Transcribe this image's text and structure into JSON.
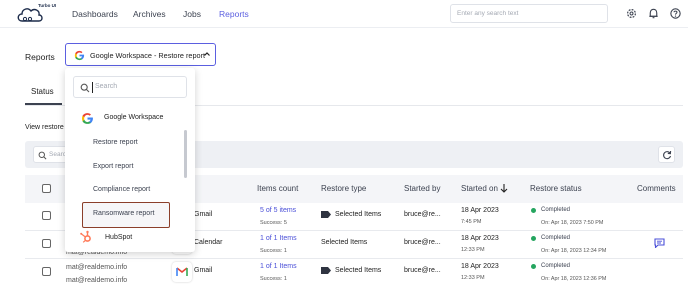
{
  "app": {
    "logo_text": "Turbo UI"
  },
  "nav": {
    "items": [
      {
        "label": "Dashboards"
      },
      {
        "label": "Archives"
      },
      {
        "label": "Jobs"
      },
      {
        "label": "Reports"
      }
    ],
    "active": "Reports"
  },
  "top_search": {
    "placeholder": "Enter any search text"
  },
  "reports": {
    "label": "Reports",
    "selected": "Google Workspace - Restore report"
  },
  "tabs": {
    "status": "Status"
  },
  "view_restore": "View restore",
  "table_search": {
    "placeholder": "Search"
  },
  "dropdown": {
    "search_placeholder": "Search",
    "group": "Google Workspace",
    "items": [
      "Restore report",
      "Export report",
      "Compliance report",
      "Ransomware report"
    ],
    "highlighted": "Ransomware report",
    "next_group": "HubSpot"
  },
  "table": {
    "headers": {
      "items_count": "Items count",
      "restore_type": "Restore type",
      "started_by": "Started by",
      "started_on": "Started on",
      "restore_status": "Restore status",
      "comments": "Comments"
    },
    "rows": [
      {
        "email": "",
        "app": "Gmail",
        "items": "5 of 5 items",
        "success": "Success:  5",
        "restore_type": "Selected Items",
        "started_by": "bruce@re...",
        "date": "18 Apr 2023",
        "time": "7:45 PM",
        "status": "Completed",
        "status_date": "On: Apr 18, 2023 7:50 PM"
      },
      {
        "email": "mat@realdemo.info",
        "app": "Calendar",
        "items": "1 of 1 Items",
        "success": "Success:  1",
        "restore_type": "Selected Items",
        "started_by": "bruce@re...",
        "date": "18 Apr 2023",
        "time": "12:33 PM",
        "status": "Completed",
        "status_date": "On: Apr 18, 2023 12:34 PM"
      },
      {
        "email": "mat@realdemo.info",
        "app": "Gmail",
        "items": "1 of 1 Items",
        "success": "Success:  1",
        "restore_type": "Selected Items",
        "started_by": "bruce@re...",
        "date": "18 Apr 2023",
        "time": "12:33 PM",
        "status": "Completed",
        "status_date": "On: Apr 18, 2023 12:36 PM"
      }
    ],
    "row4_email": "mat@realdemo.info"
  },
  "colors": {
    "accent": "#5b5fe0",
    "link": "#4a4fd8",
    "success": "#25a55f",
    "highlight_border": "#8b3f2a"
  }
}
